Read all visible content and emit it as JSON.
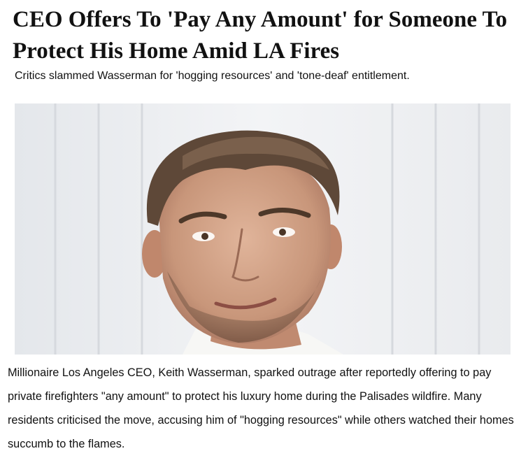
{
  "article": {
    "headline": "CEO Offers To 'Pay Any Amount' for Someone To Protect His Home Amid LA Fires",
    "subheadline": "Critics slammed Wasserman for 'hogging resources' and 'tone-deaf' entitlement.",
    "body": "Millionaire Los Angeles CEO, Keith Wasserman, sparked outrage after reportedly offering to pay private firefighters \"any amount\" to protect his luxury home during the Palisades wildfire. Many residents criticised the move, accusing him of \"hogging resources\" while others watched their homes succumb to the flames."
  }
}
